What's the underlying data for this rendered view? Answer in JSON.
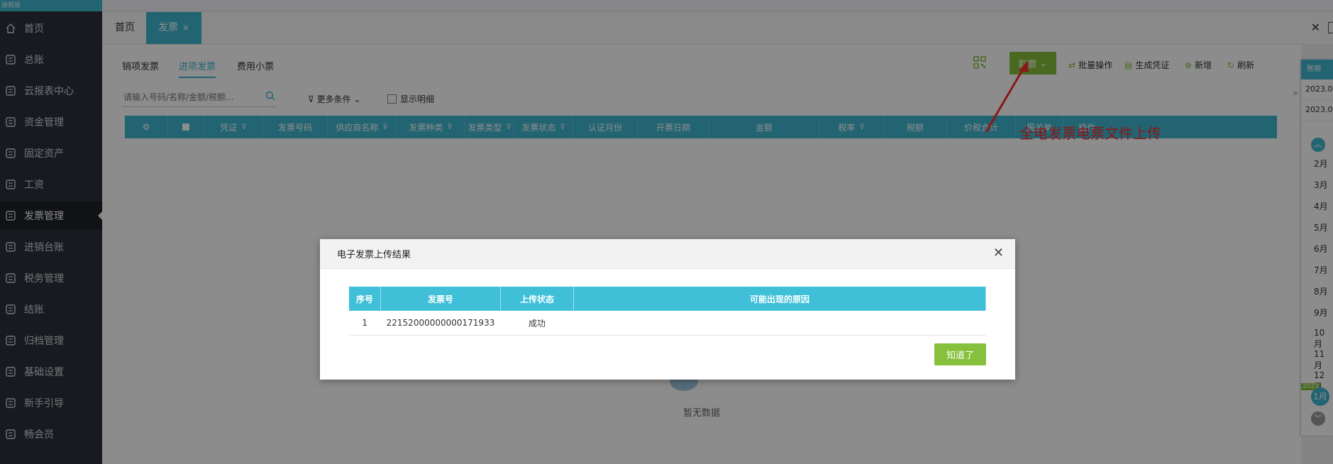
{
  "sidebar": {
    "brand": "旗舰版",
    "items": [
      {
        "label": "首页",
        "icon": "home-icon"
      },
      {
        "label": "总账",
        "icon": "ledger-icon"
      },
      {
        "label": "云报表中心",
        "icon": "chart-icon"
      },
      {
        "label": "资金管理",
        "icon": "money-icon"
      },
      {
        "label": "固定资产",
        "icon": "asset-icon"
      },
      {
        "label": "工资",
        "icon": "salary-icon"
      },
      {
        "label": "发票管理",
        "icon": "invoice-icon"
      },
      {
        "label": "进销台账",
        "icon": "account-icon"
      },
      {
        "label": "税务管理",
        "icon": "tax-icon"
      },
      {
        "label": "结账",
        "icon": "close-account-icon"
      },
      {
        "label": "归档管理",
        "icon": "archive-icon"
      },
      {
        "label": "基础设置",
        "icon": "settings-icon"
      },
      {
        "label": "新手引导",
        "icon": "guide-icon"
      },
      {
        "label": "畅会员",
        "icon": "vip-icon"
      }
    ],
    "active_index": 6
  },
  "tabs": {
    "home": "首页",
    "invoice": "发票",
    "close": "×"
  },
  "subtabs": [
    "销项发票",
    "进项发票",
    "费用小票"
  ],
  "search": {
    "placeholder": "请输入号码/名称/金额/税额..."
  },
  "filters": {
    "more": "更多条件",
    "show_detail": "显示明细"
  },
  "toolbar": {
    "fetch": "取票",
    "batch": "批量操作",
    "voucher": "生成凭证",
    "add": "新增",
    "refresh": "刷新"
  },
  "table": {
    "headers": [
      "凭证",
      "发票号码",
      "供应商名称",
      "发票种类",
      "发票类型",
      "发票状态",
      "认证月份",
      "开票日期",
      "金额",
      "税率",
      "税额",
      "价税合计",
      "报关单",
      "操作"
    ]
  },
  "empty_text": "暂无数据",
  "annotation": "全电发票电票文件上传",
  "calendar": {
    "header": "账期",
    "dates": [
      "2023.0",
      "2023.0"
    ],
    "months": [
      "2月",
      "3月",
      "4月",
      "5月",
      "6月",
      "7月",
      "8月",
      "9月",
      "10月",
      "11月",
      "12月"
    ],
    "year": "2023",
    "current": "1月"
  },
  "modal": {
    "title": "电子发票上传结果",
    "headers": [
      "序号",
      "发票号",
      "上传状态",
      "可能出现的原因"
    ],
    "rows": [
      {
        "seq": "1",
        "invoice_no": "22152000000000171933",
        "status": "成功",
        "reason": ""
      }
    ],
    "ok": "知道了"
  },
  "colors": {
    "accent": "#3fb6cf",
    "green": "#86c03c",
    "sidebar": "#2c303b",
    "annotation": "#ff2a2a"
  }
}
